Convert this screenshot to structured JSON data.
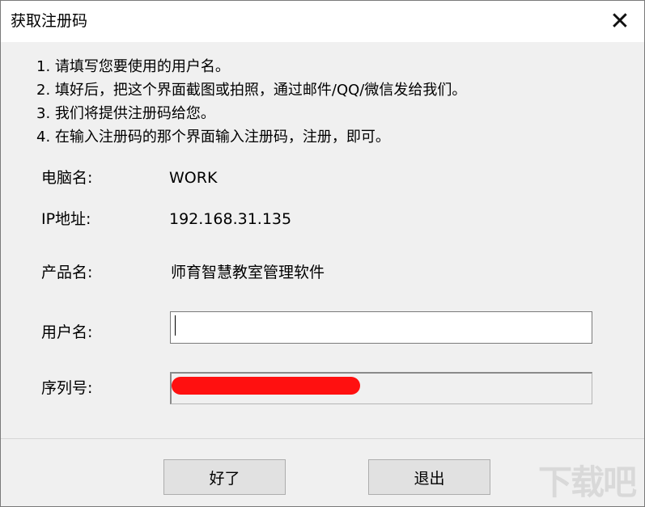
{
  "window": {
    "title": "获取注册码",
    "close_glyph": "✕"
  },
  "instructions": [
    "1. 请填写您要使用的用户名。",
    "2. 填好后，把这个界面截图或拍照，通过邮件/QQ/微信发给我们。",
    "3. 我们将提供注册码给您。",
    "4. 在输入注册码的那个界面输入注册码，注册，即可。"
  ],
  "fields": {
    "computer_name_label": "电脑名:",
    "computer_name_value": "WORK",
    "ip_label": "IP地址:",
    "ip_value": "192.168.31.135",
    "product_label": "产品名:",
    "product_value": "师育智慧教室管理软件",
    "username_label": "用户名:",
    "username_value": "",
    "serial_label": "序列号:",
    "serial_value": ""
  },
  "buttons": {
    "ok_label": "好了",
    "exit_label": "退出"
  },
  "watermark": {
    "text": "下载吧"
  },
  "colors": {
    "redaction": "#ff1010",
    "dialog_bg": "#f0f0f0"
  }
}
